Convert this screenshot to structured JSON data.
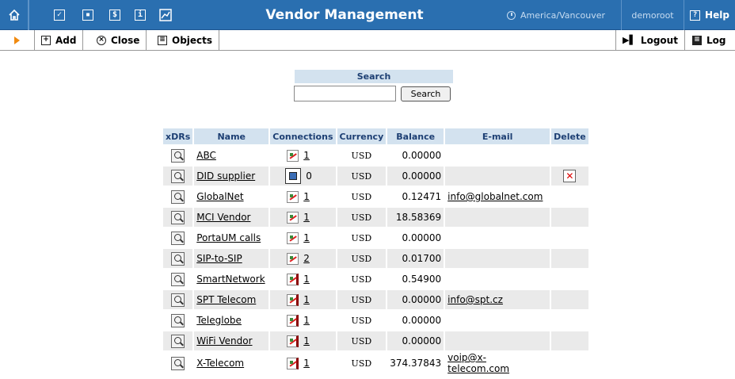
{
  "titlebar": {
    "title": "Vendor Management",
    "timezone": "America/Vancouver",
    "user": "demoroot",
    "help_label": "Help",
    "icons": [
      "home-icon",
      "checkbox-icon",
      "grid-icon",
      "dollar-icon",
      "info-icon",
      "chart-icon"
    ]
  },
  "toolbar": {
    "add_label": "Add",
    "close_label": "Close",
    "objects_label": "Objects",
    "logout_label": "Logout",
    "log_label": "Log"
  },
  "search": {
    "title": "Search",
    "input_value": "",
    "button_label": "Search"
  },
  "table": {
    "headers": [
      "xDRs",
      "Name",
      "Connections",
      "Currency",
      "Balance",
      "E-mail",
      "Delete"
    ],
    "rows": [
      {
        "name": "ABC",
        "connections": "1",
        "conn_link": true,
        "currency": "USD",
        "balance": "0.00000",
        "email": "",
        "deletable": false
      },
      {
        "name": "DID supplier",
        "connections": "0",
        "conn_link": false,
        "currency": "USD",
        "balance": "0.00000",
        "email": "",
        "deletable": true
      },
      {
        "name": "GlobalNet",
        "connections": "1",
        "conn_link": true,
        "currency": "USD",
        "balance": "0.12471",
        "email": "info@globalnet.com",
        "deletable": false
      },
      {
        "name": "MCI Vendor",
        "connections": "1",
        "conn_link": true,
        "currency": "USD",
        "balance": "18.58369",
        "email": "",
        "deletable": false
      },
      {
        "name": "PortaUM calls",
        "connections": "1",
        "conn_link": true,
        "currency": "USD",
        "balance": "0.00000",
        "email": "",
        "deletable": false
      },
      {
        "name": "SIP-to-SIP",
        "connections": "2",
        "conn_link": true,
        "currency": "USD",
        "balance": "0.01700",
        "email": "",
        "deletable": false
      },
      {
        "name": "SmartNetwork",
        "connections": "1",
        "conn_link": true,
        "currency": "USD",
        "balance": "0.54900",
        "email": "",
        "deletable": false
      },
      {
        "name": "SPT Telecom",
        "connections": "1",
        "conn_link": true,
        "currency": "USD",
        "balance": "0.00000",
        "email": "info@spt.cz",
        "deletable": false
      },
      {
        "name": "Teleglobe",
        "connections": "1",
        "conn_link": true,
        "currency": "USD",
        "balance": "0.00000",
        "email": "",
        "deletable": false
      },
      {
        "name": "WiFi Vendor",
        "connections": "1",
        "conn_link": true,
        "currency": "USD",
        "balance": "0.00000",
        "email": "",
        "deletable": false
      },
      {
        "name": "X-Telecom",
        "connections": "1",
        "conn_link": true,
        "currency": "USD",
        "balance": "374.37843",
        "email": "voip@x-telecom.com",
        "deletable": false
      }
    ]
  },
  "colors": {
    "titlebar_bg": "#2a6fb0",
    "header_bg": "#d3e2ef",
    "accent": "#f08a10"
  }
}
